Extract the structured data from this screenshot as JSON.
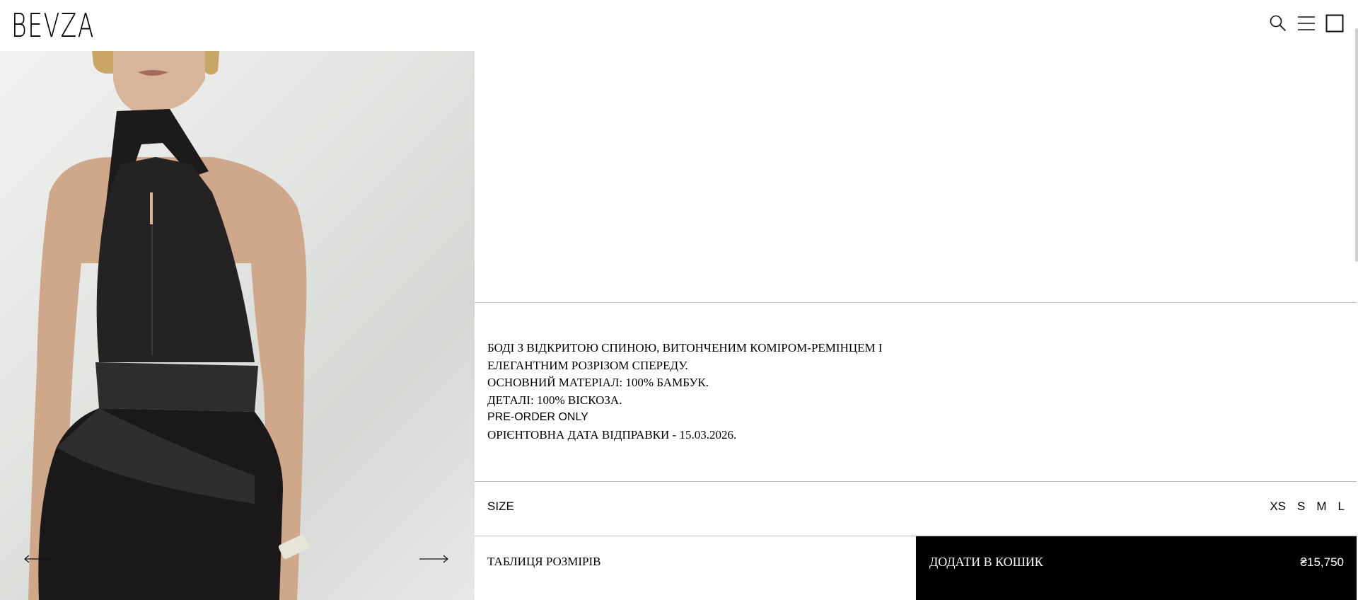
{
  "header": {
    "logo": "BEVZA",
    "icons": [
      "search-icon",
      "menu-icon",
      "cart-icon"
    ]
  },
  "gallery": {
    "prev_icon": "arrow-left-icon",
    "next_icon": "arrow-right-icon"
  },
  "product": {
    "description_lines": [
      "БОДІ З ВІДКРИТОЮ СПИНОЮ, ВИТОНЧЕНИМ КОМІРОМ-РЕМІНЦЕМ І",
      "ЕЛЕГАНТНИМ РОЗРІЗОМ СПЕРЕДУ.",
      "ОСНОВНИЙ МАТЕРІАЛ: 100% БАМБУК.",
      "ДЕТАЛІ: 100% ВІСКОЗА.",
      "PRE-ORDER ONLY",
      "ОРІЄНТОВНА ДАТА ВІДПРАВКИ - 15.03.2026."
    ],
    "size_label": "SIZE",
    "sizes": [
      "XS",
      "S",
      "M",
      "L"
    ],
    "size_chart_label": "ТАБЛИЦЯ РОЗМІРІВ",
    "add_to_cart_label": "ДОДАТИ В КОШИК",
    "price": "₴15,750"
  }
}
